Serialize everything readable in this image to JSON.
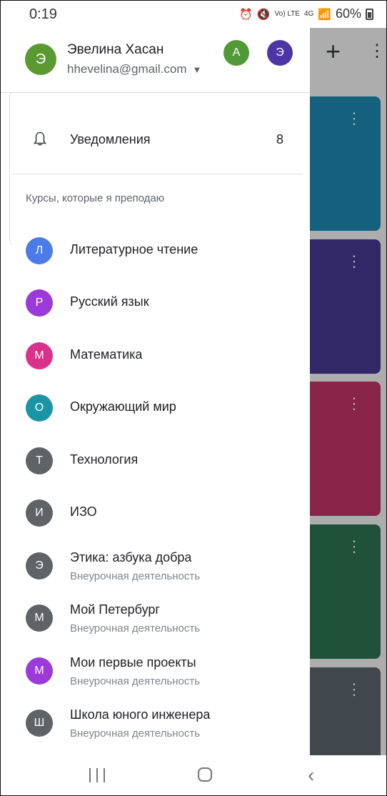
{
  "status_bar": {
    "time": "0:19",
    "volte": "Vo) LTE",
    "network": "4G",
    "battery": "60%"
  },
  "account": {
    "name": "Эвелина Хасан",
    "email": "hhevelina@gmail.com",
    "avatar_letter": "Э",
    "other_accounts": [
      {
        "letter": "A",
        "color": "#4f9a35"
      },
      {
        "letter": "Э",
        "color": "#4e35a6"
      }
    ]
  },
  "notifications": {
    "label": "Уведомления",
    "count": "8"
  },
  "section_title": "Курсы, которые я преподаю",
  "courses": [
    {
      "letter": "Л",
      "name": "Литературное чтение",
      "subtitle": "",
      "color": "#4a7be8"
    },
    {
      "letter": "Р",
      "name": "Русский язык",
      "subtitle": "",
      "color": "#9b3ad8"
    },
    {
      "letter": "М",
      "name": "Математика",
      "subtitle": "",
      "color": "#d8328c"
    },
    {
      "letter": "О",
      "name": "Окружающий мир",
      "subtitle": "",
      "color": "#1b95a5"
    },
    {
      "letter": "Т",
      "name": "Технология",
      "subtitle": "",
      "color": "#5f6368"
    },
    {
      "letter": "И",
      "name": "ИЗО",
      "subtitle": "",
      "color": "#5f6368"
    },
    {
      "letter": "Э",
      "name": "Этика: азбука добра",
      "subtitle": "Внеурочная деятельность",
      "color": "#5f6368"
    },
    {
      "letter": "М",
      "name": "Мой Петербург",
      "subtitle": "Внеурочная деятельность",
      "color": "#5f6368"
    },
    {
      "letter": "М",
      "name": "Мои первые проекты",
      "subtitle": "Внеурочная деятельность",
      "color": "#9b3ad8"
    },
    {
      "letter": "Ш",
      "name": "Школа юного инженера",
      "subtitle": "Внеурочная деятельность",
      "color": "#5f6368"
    }
  ],
  "background": {
    "plus_icon": "+",
    "more_icon": "⋮",
    "card_colors": [
      "#1f8fb8",
      "#4a3c9a",
      "#c8356a",
      "#2f7a55",
      "#5f6b73"
    ]
  },
  "navbar": {
    "back_icon": "‹"
  }
}
